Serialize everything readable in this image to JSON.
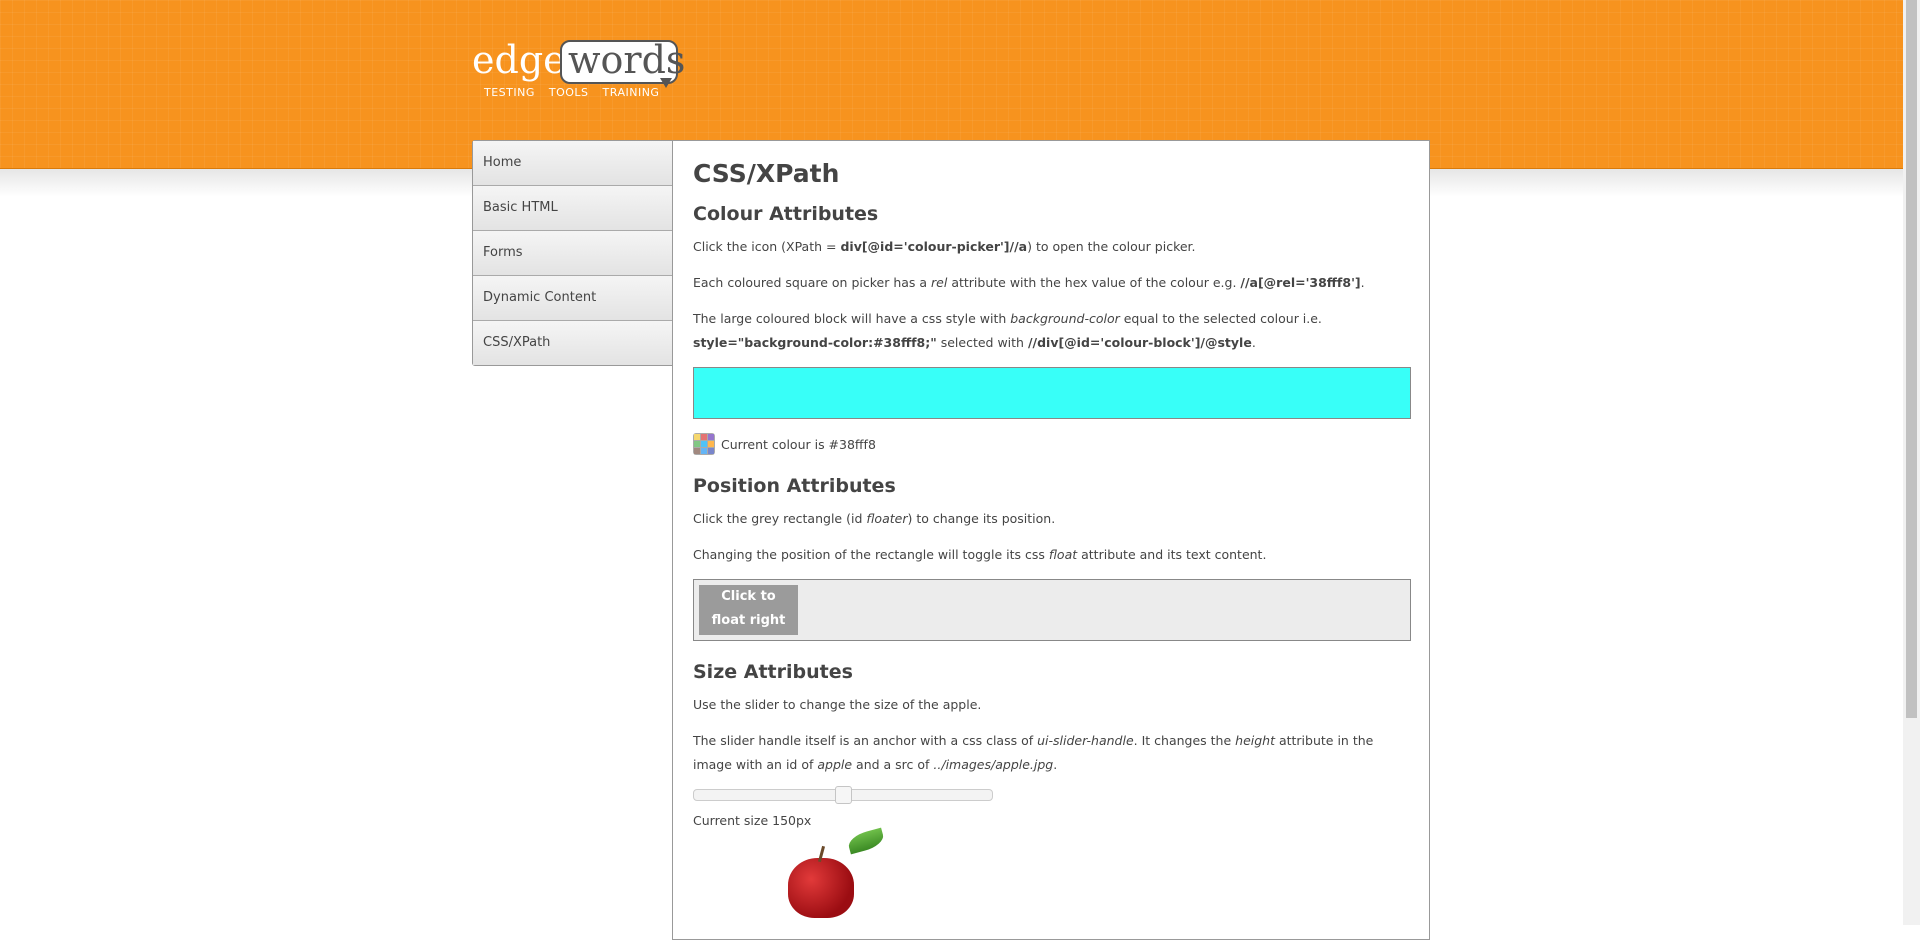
{
  "logo": {
    "edge": "edge",
    "words": "words",
    "tagline": [
      "TESTING",
      "TOOLS",
      "TRAINING"
    ]
  },
  "nav": {
    "items": [
      "Home",
      "Basic HTML",
      "Forms",
      "Dynamic Content",
      "CSS/XPath"
    ]
  },
  "page": {
    "title": "CSS/XPath",
    "colour": {
      "heading": "Colour Attributes",
      "p1_pre": "Click the icon (XPath = ",
      "p1_code": "div[@id='colour-picker']//a",
      "p1_post": ") to open the colour picker.",
      "p2_pre": "Each coloured square on picker has a ",
      "p2_em": "rel",
      "p2_mid": " attribute with the hex value of the colour e.g. ",
      "p2_code": "//a[@rel='38fff8']",
      "p2_post": ".",
      "p3_pre": "The large coloured block will have a css style with ",
      "p3_em": "background-color",
      "p3_mid": " equal to the selected colour i.e.",
      "p3_code1": "style=\"background-color:#38fff8;\"",
      "p3_mid2": " selected with ",
      "p3_code2": "//div[@id='colour-block']/@style",
      "p3_post": ".",
      "block_color": "#38fff8",
      "current_label": "Current colour is #38fff8"
    },
    "position": {
      "heading": "Position Attributes",
      "p1_pre": "Click the grey rectangle (id ",
      "p1_em": "floater",
      "p1_post": ") to change its position.",
      "p2_pre": "Changing the position of the rectangle will toggle its css ",
      "p2_em": "float",
      "p2_post": " attribute and its text content.",
      "floater_line1": "Click to",
      "floater_line2": "float right"
    },
    "size": {
      "heading": "Size Attributes",
      "p1": "Use the slider to change the size of the apple.",
      "p2_pre": "The slider handle itself is an anchor with a css class of ",
      "p2_em1": "ui-slider-handle",
      "p2_mid1": ". It changes the ",
      "p2_em2": "height",
      "p2_mid2": " attribute in the image with an id of ",
      "p2_em3": "apple",
      "p2_mid3": " and a src of ",
      "p2_em4": "../images/apple.jpg",
      "p2_post": ".",
      "current_size": "Current size 150px",
      "slider_value": 0.5
    }
  },
  "colors": {
    "header": "#f7931e",
    "accent_block": "#38fff8",
    "floater": "#9b9b9b"
  }
}
